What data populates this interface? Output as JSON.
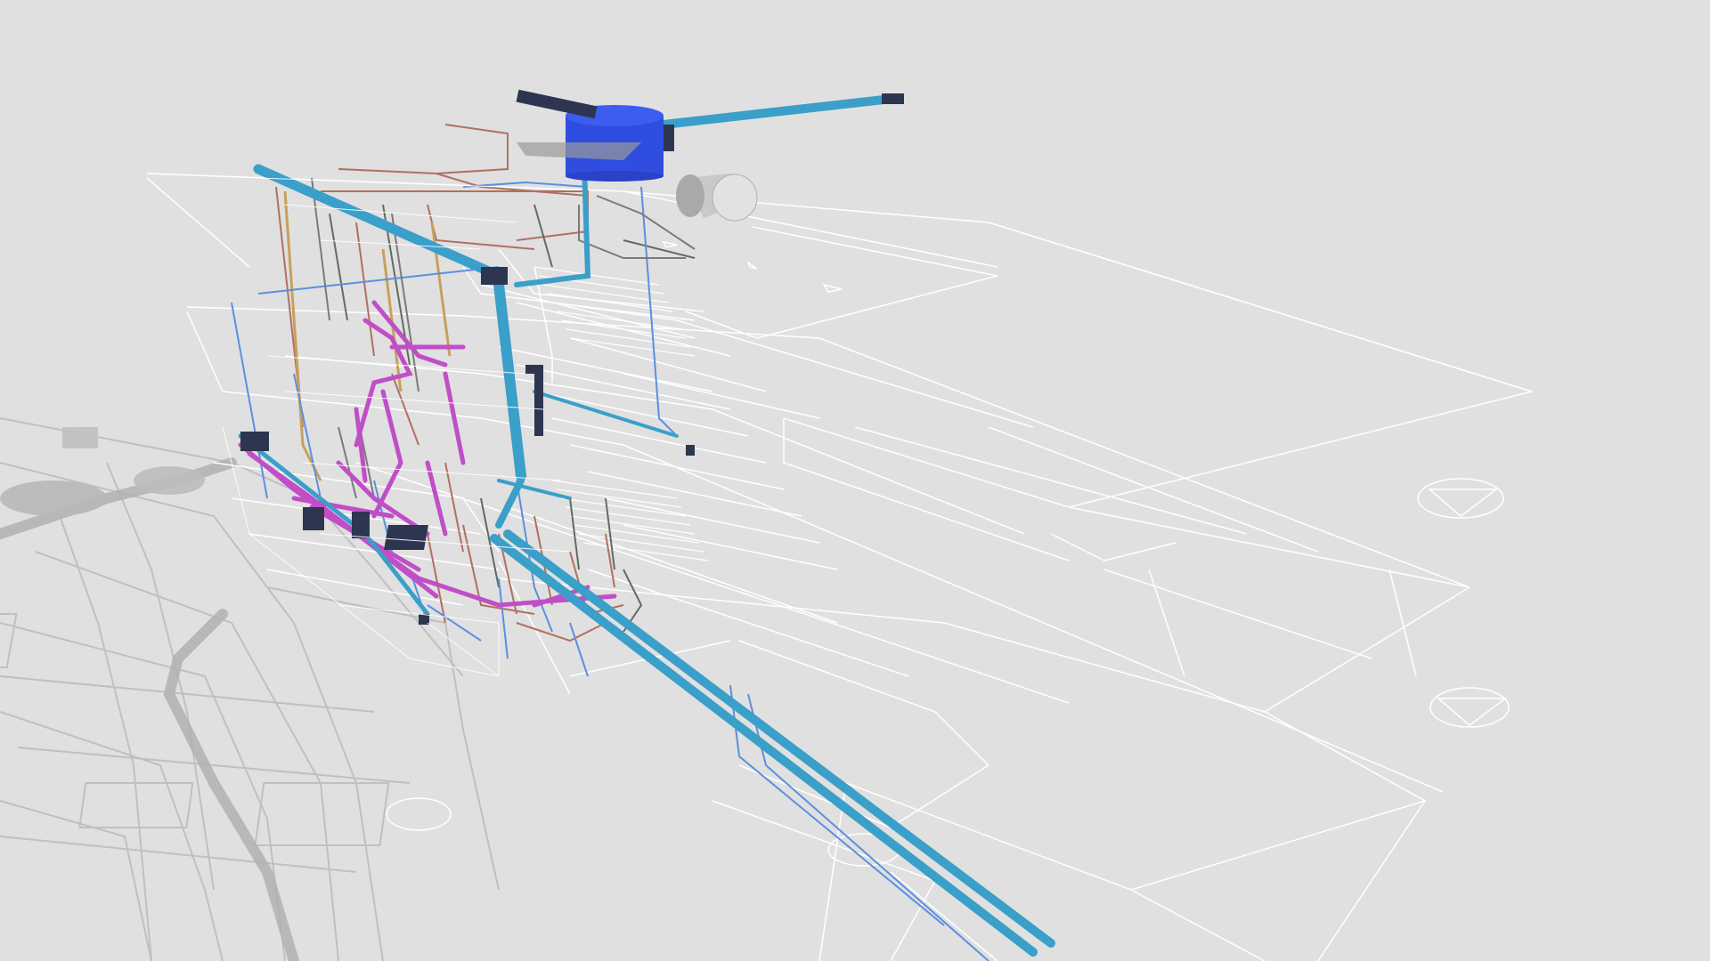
{
  "scene": {
    "background": "#e0e0e0",
    "floorplan_line_color": "#ffffff",
    "shadow_color": "#b5b5b5",
    "systems": [
      {
        "name": "storm-drain-pipe",
        "color": "#3a9fc9"
      },
      {
        "name": "sanitary-pipe",
        "color": "#c04ec7"
      },
      {
        "name": "hot-water-pipe",
        "color": "#c8a05a"
      },
      {
        "name": "cold-water-pipe",
        "color": "#5b8fe0"
      },
      {
        "name": "gas-pipe",
        "color": "#b07060"
      },
      {
        "name": "vent-pipe",
        "color": "#607060"
      }
    ],
    "roof_tank_color": "#2f4ee0",
    "water_heater_color": "#cfcfcf",
    "fitting_color": "#2d3550"
  }
}
